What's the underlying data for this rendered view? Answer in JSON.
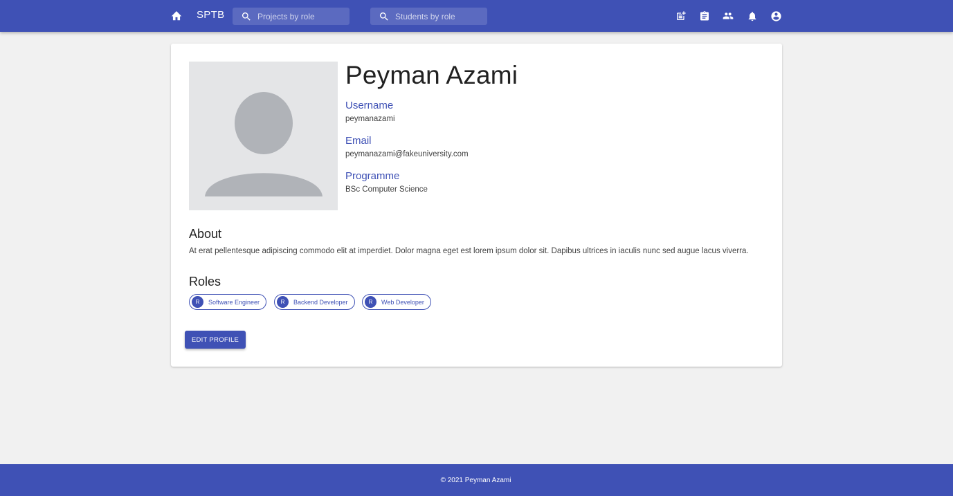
{
  "appbar": {
    "brand": "SPTB",
    "search_projects_placeholder": "Projects by role",
    "search_students_placeholder": "Students by role",
    "icons": [
      "home-icon",
      "search-icon",
      "post-add-icon",
      "assignment-icon",
      "people-icon",
      "notifications-icon",
      "account-circle-icon"
    ]
  },
  "profile": {
    "name": "Peyman Azami",
    "username_label": "Username",
    "username": "peymanazami",
    "email_label": "Email",
    "email": "peymanazami@fakeuniversity.com",
    "programme_label": "Programme",
    "programme": "BSc Computer Science",
    "about_title": "About",
    "about_text": "At erat pellentesque adipiscing commodo elit at imperdiet. Dolor magna eget est lorem ipsum dolor sit. Dapibus ultrices in iaculis nunc sed augue lacus viverra.",
    "roles_title": "Roles",
    "roles": [
      {
        "avatar": "R",
        "label": "Software Engineer"
      },
      {
        "avatar": "R",
        "label": "Backend Developer"
      },
      {
        "avatar": "R",
        "label": "Web Developer"
      }
    ],
    "edit_button": "EDIT PROFILE"
  },
  "footer": {
    "text": "© 2021 Peyman Azami"
  },
  "colors": {
    "primary": "#3f51b5",
    "background": "#f1f1f1",
    "avatar_bg": "#e4e5e7",
    "avatar_fg": "#b0b3b8"
  }
}
